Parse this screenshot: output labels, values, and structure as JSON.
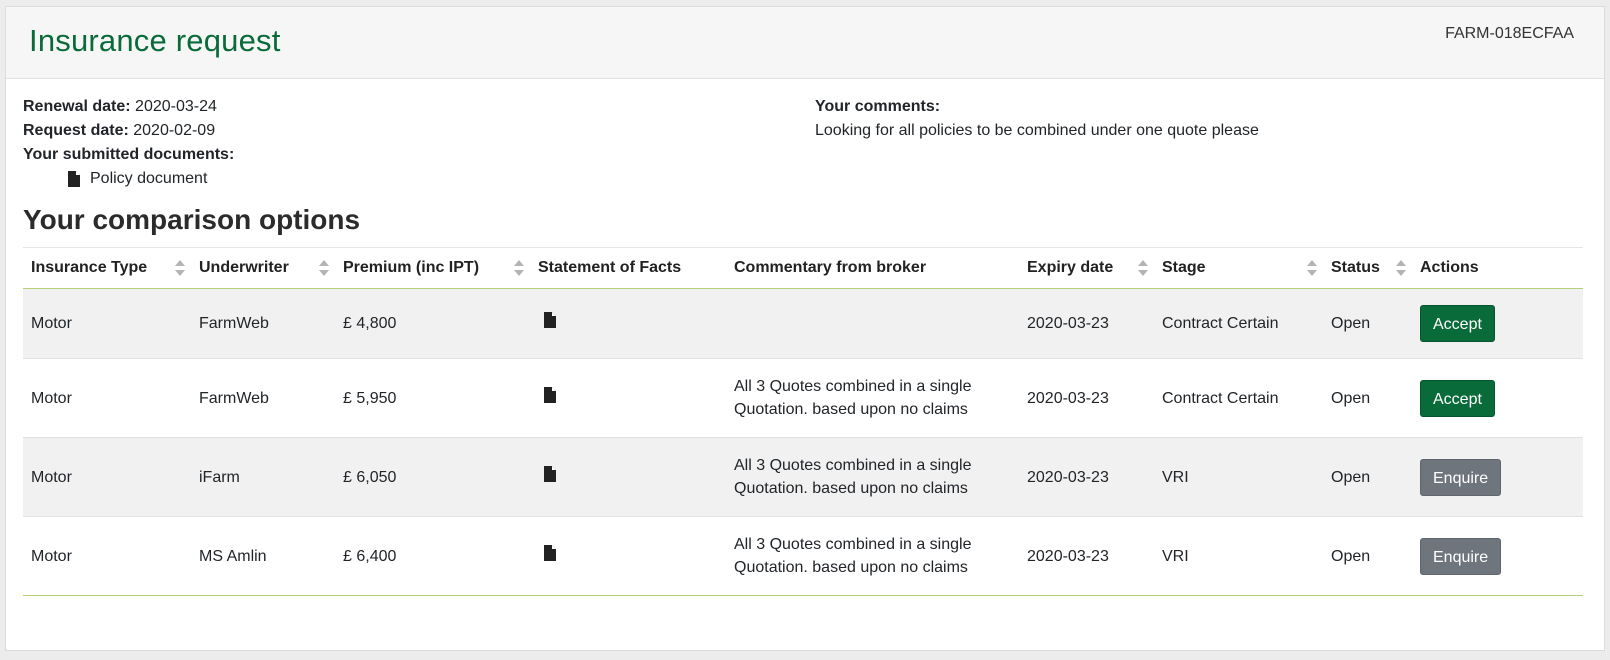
{
  "header": {
    "title": "Insurance request",
    "reference": "FARM-018ECFAA"
  },
  "details": {
    "renewal_label": "Renewal date:",
    "renewal_value": "2020-03-24",
    "request_label": "Request date:",
    "request_value": "2020-02-09",
    "documents_label": "Your submitted documents:",
    "documents": [
      {
        "name": "Policy document",
        "icon": "file-icon"
      }
    ],
    "comments_label": "Your comments:",
    "comments_value": "Looking for all policies to be combined under one quote please"
  },
  "comparison": {
    "title": "Your comparison options",
    "columns": [
      {
        "label": "Insurance Type",
        "sortable": true
      },
      {
        "label": "Underwriter",
        "sortable": true
      },
      {
        "label": "Premium (inc IPT)",
        "sortable": true
      },
      {
        "label": "Statement of Facts",
        "sortable": false
      },
      {
        "label": "Commentary from broker",
        "sortable": false
      },
      {
        "label": "Expiry date",
        "sortable": true
      },
      {
        "label": "Stage",
        "sortable": true
      },
      {
        "label": "Status",
        "sortable": true
      },
      {
        "label": "Actions",
        "sortable": false
      }
    ],
    "rows": [
      {
        "type": "Motor",
        "underwriter": "FarmWeb",
        "premium": "£ 4,800",
        "sof_icon": "file-icon",
        "commentary": "",
        "expiry": "2020-03-23",
        "stage": "Contract Certain",
        "status": "Open",
        "action": "Accept"
      },
      {
        "type": "Motor",
        "underwriter": "FarmWeb",
        "premium": "£ 5,950",
        "sof_icon": "file-icon",
        "commentary": "All 3 Quotes combined in a single Quotation. based upon no claims",
        "expiry": "2020-03-23",
        "stage": "Contract Certain",
        "status": "Open",
        "action": "Accept"
      },
      {
        "type": "Motor",
        "underwriter": "iFarm",
        "premium": "£ 6,050",
        "sof_icon": "file-icon",
        "commentary": "All 3 Quotes combined in a single Quotation. based upon no claims",
        "expiry": "2020-03-23",
        "stage": "VRI",
        "status": "Open",
        "action": "Enquire"
      },
      {
        "type": "Motor",
        "underwriter": "MS Amlin",
        "premium": "£ 6,400",
        "sof_icon": "file-icon",
        "commentary": "All 3 Quotes combined in a single Quotation. based upon no claims",
        "expiry": "2020-03-23",
        "stage": "VRI",
        "status": "Open",
        "action": "Enquire"
      }
    ]
  },
  "colors": {
    "brand_green": "#0a6b3a",
    "accept_button": "#0a6b3a",
    "enquire_button": "#6e757c",
    "table_rule": "#b6d07a"
  }
}
